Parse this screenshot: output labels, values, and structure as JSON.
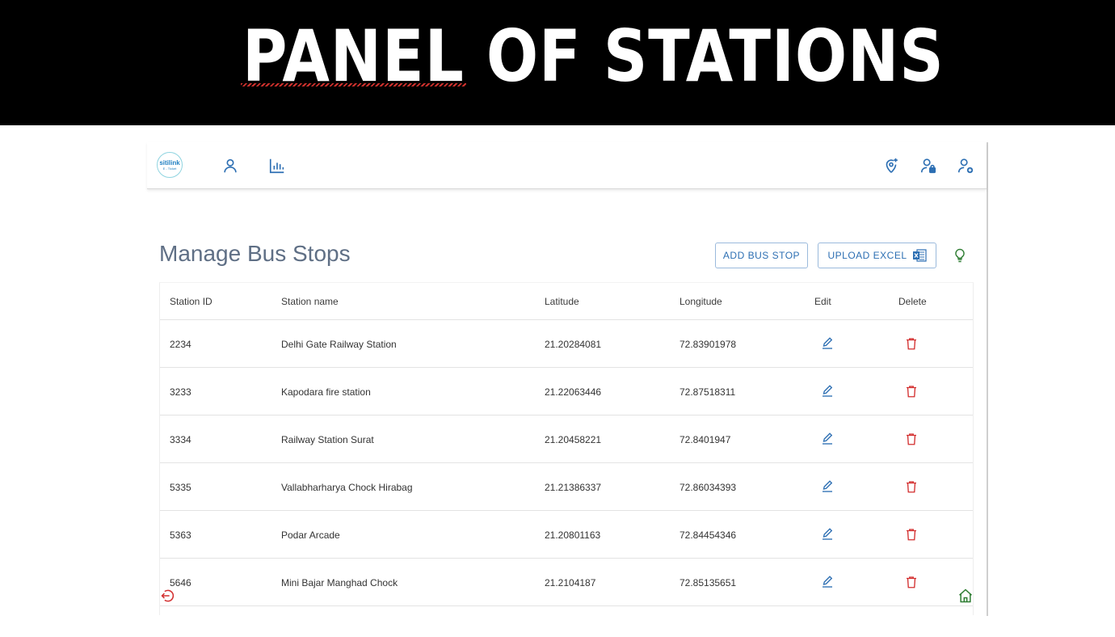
{
  "banner": {
    "title": "PANEL OF STATIONS"
  },
  "navbar": {
    "logo": {
      "main": "sitilink",
      "sub": "E - Ticket"
    },
    "icons_left": [
      "user-icon",
      "bar-chart-icon"
    ],
    "icons_right": [
      "add-location-icon",
      "user-lock-icon",
      "add-user-icon"
    ]
  },
  "page": {
    "title": "Manage Bus Stops",
    "add_button": "ADD BUS STOP",
    "upload_button": "UPLOAD EXCEL",
    "accent_color": "#2d6fb3",
    "delete_color": "#d32f2f"
  },
  "table": {
    "headers": [
      "Station ID",
      "Station name",
      "Latitude",
      "Longitude",
      "Edit",
      "Delete"
    ],
    "rows": [
      {
        "id": "2234",
        "name": "Delhi Gate Railway Station",
        "lat": "21.20284081",
        "lng": "72.83901978"
      },
      {
        "id": "3233",
        "name": "Kapodara fire station",
        "lat": "21.22063446",
        "lng": "72.87518311"
      },
      {
        "id": "3334",
        "name": "Railway Station Surat",
        "lat": "21.20458221",
        "lng": "72.8401947"
      },
      {
        "id": "5335",
        "name": "Vallabharharya Chock Hirabag",
        "lat": "21.21386337",
        "lng": "72.86034393"
      },
      {
        "id": "5363",
        "name": "Podar Arcade",
        "lat": "21.20801163",
        "lng": "72.84454346"
      },
      {
        "id": "5646",
        "name": "Mini Bajar Manghad Chock",
        "lat": "21.2104187",
        "lng": "72.85135651"
      }
    ]
  }
}
